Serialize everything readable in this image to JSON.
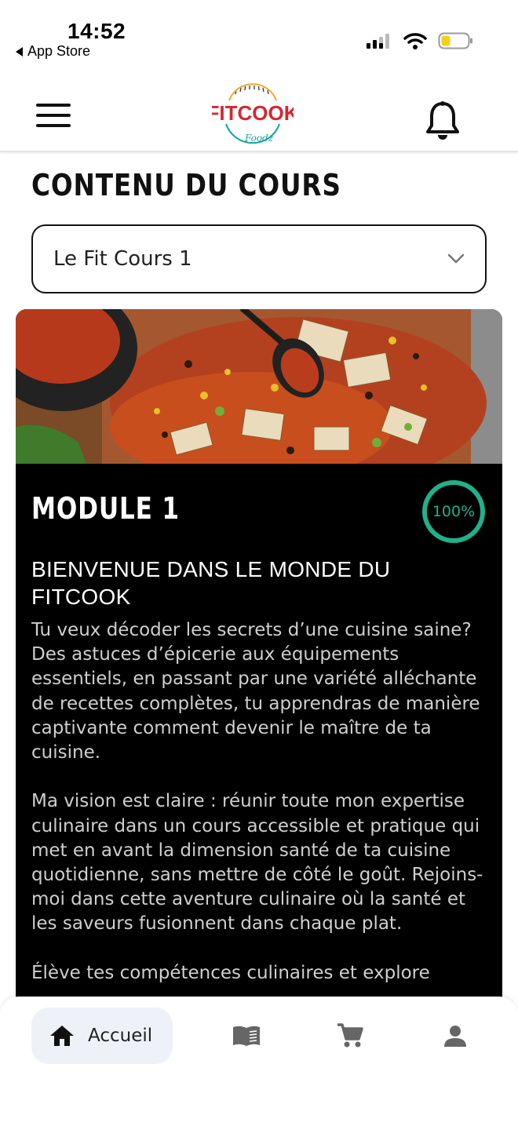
{
  "status_bar": {
    "time": "14:52",
    "back_label": "App Store"
  },
  "header": {
    "logo_text": "FITCOOK",
    "logo_subtext": "Foodz"
  },
  "page": {
    "title": "CONTENU DU COURS"
  },
  "course_select": {
    "value": "Le Fit Cours 1"
  },
  "module": {
    "title": "MODULE 1",
    "progress_label": "100%",
    "progress_value": 1.0,
    "heading": "BIENVENUE DANS LE MONDE DU FITCOOK",
    "paragraphs": [
      "Tu veux décoder les secrets d’une cuisine saine? Des astuces d’épicerie aux équipements essentiels, en passant par une variété alléchante de recettes complètes, tu apprendras de manière captivante comment devenir le maître de ta cuisine.",
      "Ma vision est claire : réunir toute mon expertise culinaire dans un cours accessible et pratique qui met en avant la dimension santé de ta cuisine quotidienne, sans mettre de côté le goût. Rejoins-moi dans cette aventure culinaire où la santé et les saveurs fusionnent dans chaque plat.",
      "Élève tes compétences culinaires et explore"
    ]
  },
  "bottom_nav": {
    "home_label": "Accueil",
    "items": [
      "home-icon",
      "book-icon",
      "cart-icon",
      "person-icon"
    ]
  },
  "colors": {
    "accent": "#22b08a",
    "logo_red": "#d6262f",
    "logo_teal": "#1aa59a"
  }
}
